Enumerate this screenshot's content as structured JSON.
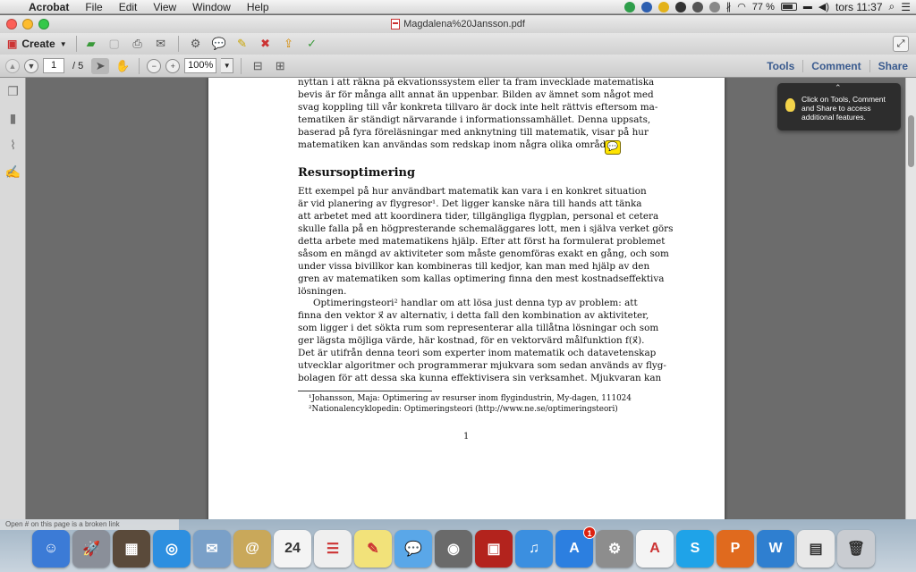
{
  "menubar": {
    "app_name": "Acrobat",
    "items": [
      "File",
      "Edit",
      "View",
      "Window",
      "Help"
    ],
    "battery_percent": "77 %",
    "clock": "tors 11:37"
  },
  "window": {
    "title": "Magdalena%20Jansson.pdf"
  },
  "toolbar": {
    "create_label": "Create",
    "page_current": "1",
    "page_total": "/ 5",
    "zoom": "100%",
    "panels": [
      "Tools",
      "Comment",
      "Share"
    ]
  },
  "tooltip": {
    "text": "Click on Tools, Comment and Share to access additional features."
  },
  "document": {
    "intro_lines": [
      "nyttan i att räkna på ekvationssystem eller ta fram invecklade matematiska",
      "bevis är för många allt annat än uppenbar. Bilden av ämnet som något med",
      "svag koppling till vår konkreta tillvaro är dock inte helt rättvis eftersom ma-",
      "tematiken är ständigt närvarande i informationssamhället. Denna uppsats,",
      "baserad på fyra föreläsningar med anknytning till matematik, visar på hur",
      "matematiken kan användas som redskap inom några olika områden."
    ],
    "heading": "Resursoptimering",
    "para1": [
      "Ett exempel på hur användbart matematik kan vara i en konkret situation",
      "är vid planering av flygresor¹. Det ligger kanske nära till hands att tänka",
      "att arbetet med att koordinera tider, tillgängliga flygplan, personal et cetera",
      "skulle falla på en högpresterande schemaläggares lott, men i själva verket görs",
      "detta arbete med matematikens hjälp. Efter att först ha formulerat problemet",
      "såsom en mängd av aktiviteter som måste genomföras exakt en gång, och som",
      "under vissa bivillkor kan kombineras till kedjor, kan man med hjälp av den",
      "gren av matematiken som kallas optimering finna den mest kostnadseffektiva",
      "lösningen."
    ],
    "para2_first": "Optimeringsteori² handlar om att lösa just denna typ av problem: att",
    "para2": [
      "finna den vektor x⃗ av alternativ, i detta fall den kombination av aktiviteter,",
      "som ligger i det sökta rum som representerar alla tillåtna lösningar och som",
      "ger lägsta möjliga värde, här kostnad, för en vektorvärd målfunktion f(x⃗).",
      "Det är utifrån denna teori som experter inom matematik och datavetenskap",
      "utvecklar algoritmer och programmerar mjukvara som sedan används av flyg-",
      "bolagen för att dessa ska kunna effektivisera sin verksamhet. Mjukvaran kan"
    ],
    "footnotes": [
      "¹Johansson, Maja: Optimering av resurser inom flygindustrin, My-dagen, 111024",
      "²Nationalencyklopedin: Optimeringsteori (http://www.ne.se/optimeringsteori)"
    ],
    "page_number": "1"
  },
  "status_text": "Open # on this page is a broken link",
  "dock": {
    "items": [
      {
        "name": "finder",
        "color": "#3c7bd6",
        "glyph": "☺"
      },
      {
        "name": "launchpad",
        "color": "#8a8f99",
        "glyph": "🚀"
      },
      {
        "name": "mission-control",
        "color": "#5a4a3a",
        "glyph": "▦"
      },
      {
        "name": "safari",
        "color": "#2d8fe0",
        "glyph": "◎"
      },
      {
        "name": "mail-bird",
        "color": "#7aa0c8",
        "glyph": "✉"
      },
      {
        "name": "address-book",
        "color": "#c9a85a",
        "glyph": "@"
      },
      {
        "name": "calendar",
        "color": "#f4f4f4",
        "glyph": "24"
      },
      {
        "name": "reminders",
        "color": "#efefef",
        "glyph": "☰"
      },
      {
        "name": "notes",
        "color": "#f2e27a",
        "glyph": "✎"
      },
      {
        "name": "messages",
        "color": "#5aa7e8",
        "glyph": "💬"
      },
      {
        "name": "facetime",
        "color": "#6a6a6a",
        "glyph": "◉"
      },
      {
        "name": "photo-booth",
        "color": "#b3231d",
        "glyph": "▣"
      },
      {
        "name": "itunes",
        "color": "#3b8fe0",
        "glyph": "♫"
      },
      {
        "name": "app-store",
        "color": "#2c7fe0",
        "glyph": "A",
        "badge": "1"
      },
      {
        "name": "system-preferences",
        "color": "#8d8d8d",
        "glyph": "⚙"
      },
      {
        "name": "acrobat",
        "color": "#f4f4f4",
        "glyph": "A"
      },
      {
        "name": "skype",
        "color": "#1fa3e8",
        "glyph": "S"
      },
      {
        "name": "powerpoint",
        "color": "#e06a1e",
        "glyph": "P"
      },
      {
        "name": "word",
        "color": "#2f7fd0",
        "glyph": "W"
      },
      {
        "name": "documents",
        "color": "#e8e8e8",
        "glyph": "▤"
      },
      {
        "name": "trash",
        "color": "#c9ccd1",
        "glyph": "🗑"
      }
    ]
  }
}
